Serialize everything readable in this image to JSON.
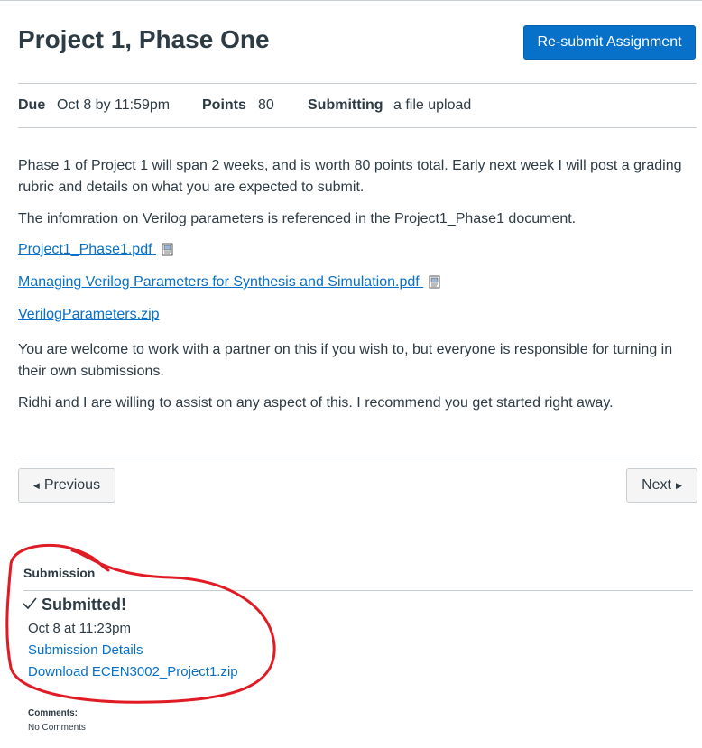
{
  "assignment": {
    "title": "Project 1, Phase One",
    "resubmit_label": "Re-submit Assignment",
    "meta": {
      "due_label": "Due",
      "due_value": "Oct 8 by 11:59pm",
      "points_label": "Points",
      "points_value": "80",
      "submitting_label": "Submitting",
      "submitting_value": "a file upload"
    },
    "description": {
      "p1": "Phase 1 of Project 1 will span 2 weeks, and is worth 80 points total.  Early next week I will post a grading rubric and details on what you are expected to submit.",
      "p2": "The infomration on Verilog parameters is referenced in the Project1_Phase1 document.",
      "p3": "You are welcome to work with a partner on this if you wish to, but everyone is responsible for turning in their own submissions.",
      "p4": "Ridhi and I are willing to assist on any aspect of this.  I recommend you get started right away."
    },
    "files": [
      {
        "label": "Project1_Phase1.pdf",
        "icon": "document-preview-icon"
      },
      {
        "label": "Managing Verilog Parameters for Synthesis and Simulation.pdf",
        "icon": "document-preview-icon"
      },
      {
        "label": "VerilogParameters.zip"
      }
    ]
  },
  "nav": {
    "previous_label": "Previous",
    "next_label": "Next"
  },
  "submission": {
    "heading": "Submission",
    "status": "Submitted!",
    "date": "Oct 8 at 11:23pm",
    "details_link": "Submission Details",
    "download_link": "Download ECEN3002_Project1.zip",
    "comments_label": "Comments:",
    "comments_value": "No Comments"
  },
  "colors": {
    "accent": "#0770c8",
    "text": "#2d3b45",
    "annotation": "#e01b24"
  }
}
